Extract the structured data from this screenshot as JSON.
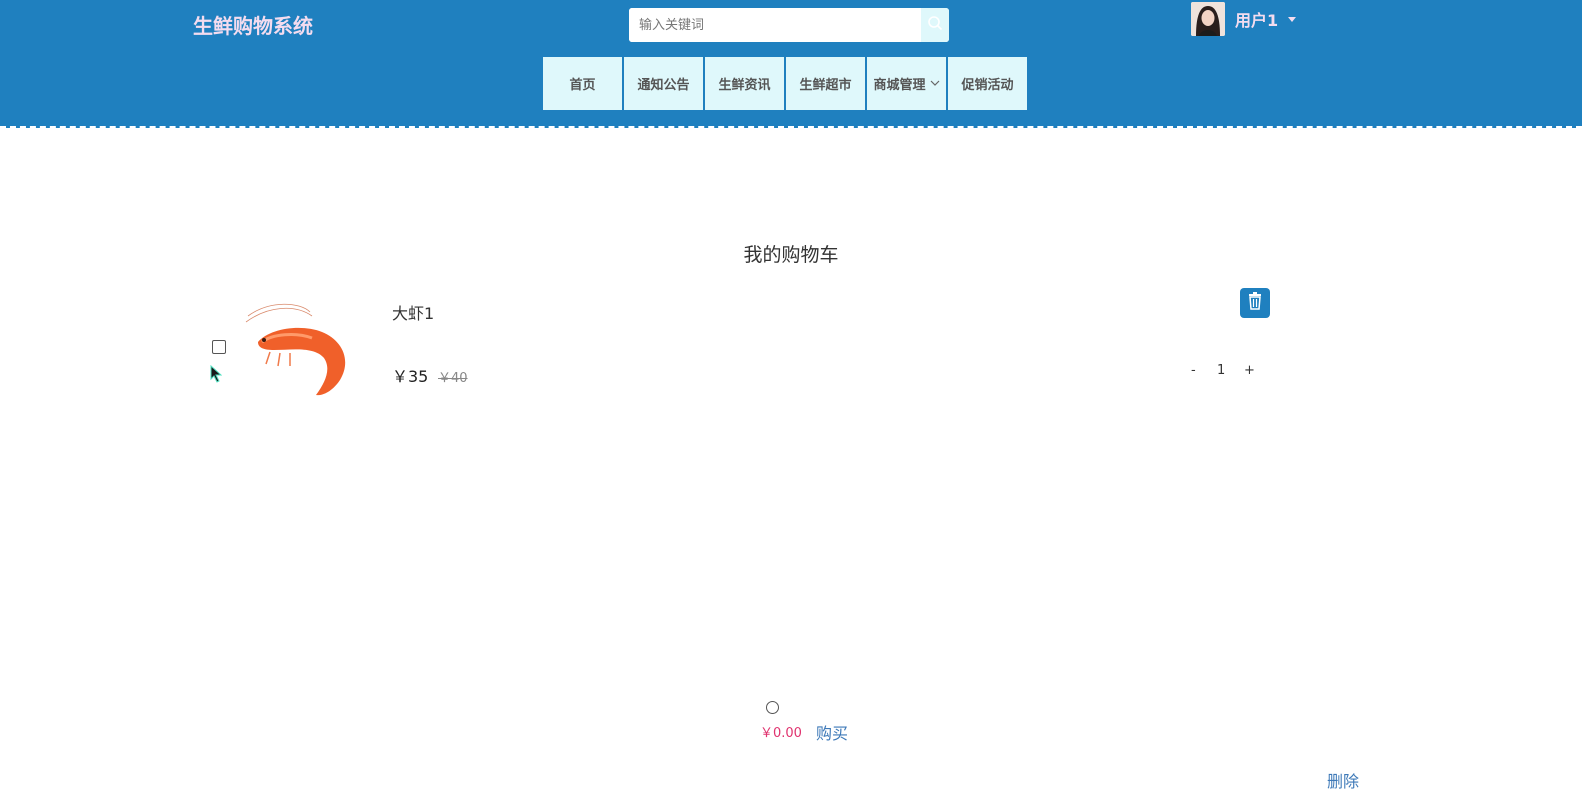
{
  "header": {
    "brand": "生鲜购物系统",
    "search": {
      "placeholder": "输入关键词",
      "value": ""
    },
    "user": {
      "name": "用户1"
    },
    "nav": [
      {
        "label": "首页"
      },
      {
        "label": "通知公告"
      },
      {
        "label": "生鲜资讯"
      },
      {
        "label": "生鲜超市"
      },
      {
        "label": "商城管理",
        "has_dropdown": true
      },
      {
        "label": "促销活动"
      }
    ]
  },
  "cart": {
    "title": "我的购物车",
    "items": [
      {
        "name": "大虾1",
        "price": "￥35",
        "original_price": "￥40",
        "quantity": "1",
        "qty_minus": "-",
        "qty_plus": "+",
        "checked": false
      }
    ],
    "total": "￥0.00",
    "buy_label": "购买",
    "delete_label": "删除"
  },
  "colors": {
    "header_bg": "#1f80bf",
    "nav_bg": "#dff8fb",
    "brand_text": "#f3dcef",
    "price_total": "#e0336f",
    "link": "#3d79b8"
  },
  "icons": [
    "search-icon",
    "chevron-down-icon",
    "caret-down-icon",
    "trash-icon",
    "cursor-icon"
  ]
}
